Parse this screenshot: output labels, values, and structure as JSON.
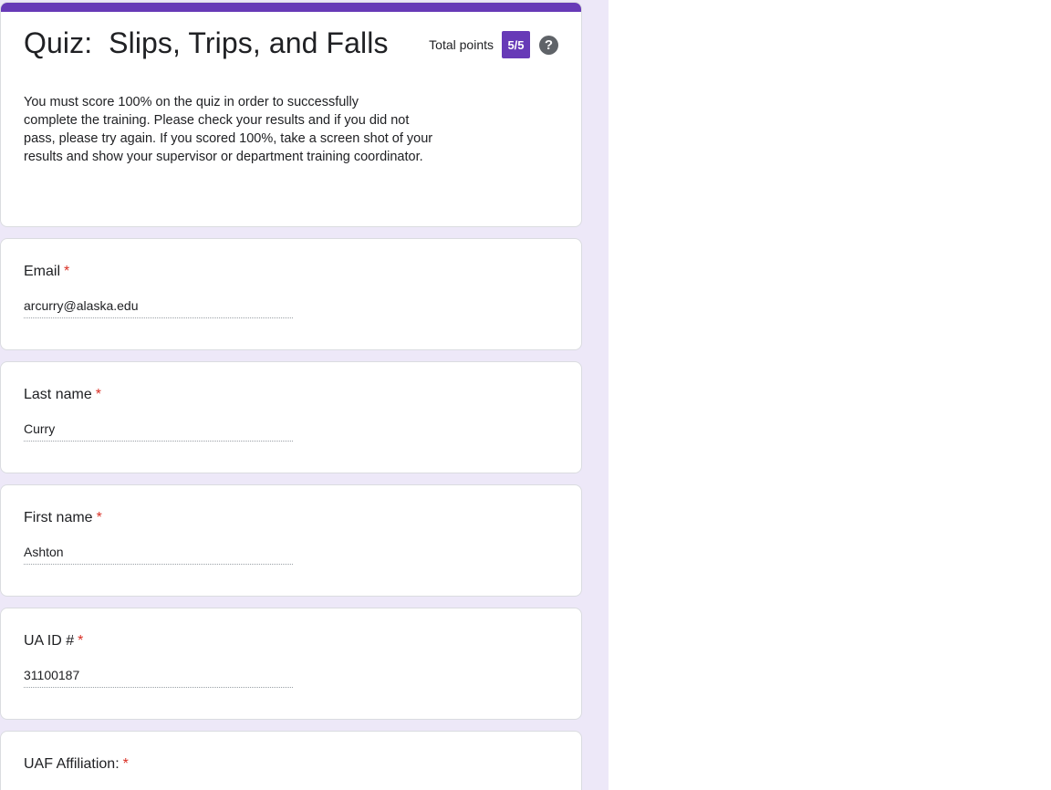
{
  "form": {
    "title": "Quiz:  Slips, Trips, and Falls",
    "total_points_label": "Total points",
    "score": "5/5",
    "help_glyph": "?",
    "description": "You must score 100% on the quiz in order to successfully\n complete the training.  Please check your results and if you did not\npass, please try again.  If you scored 100%, take a screen shot of your\nresults and show your supervisor or department training coordinator.",
    "accent_color": "#673ab7",
    "background_color": "#ede8f8"
  },
  "questions": [
    {
      "label": "Email",
      "required": "*",
      "answer": "arcurry@alaska.edu"
    },
    {
      "label": "Last name",
      "required": "*",
      "answer": "Curry"
    },
    {
      "label": "First name",
      "required": "*",
      "answer": "Ashton"
    },
    {
      "label": "UA ID #",
      "required": "*",
      "answer": "31100187"
    },
    {
      "label": "UAF Affiliation:",
      "required": "*"
    }
  ],
  "icons": {
    "help": "help-circle-icon"
  }
}
